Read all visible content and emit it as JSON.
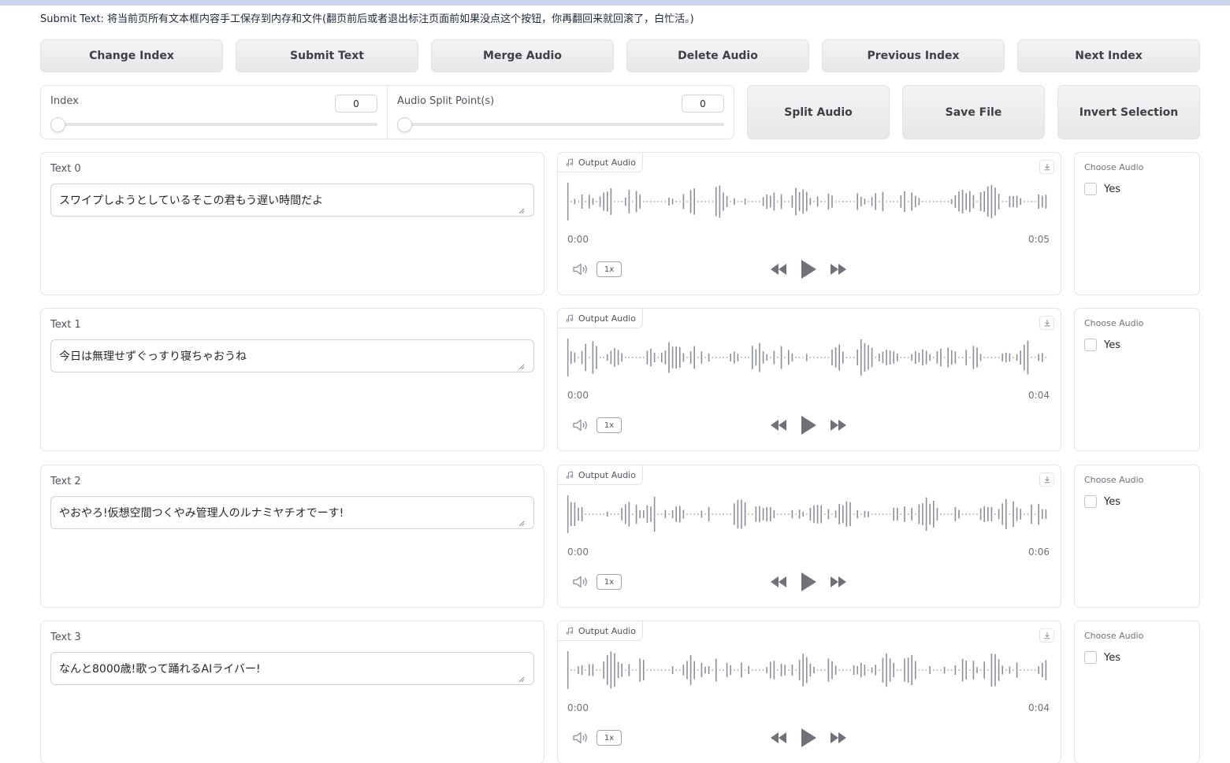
{
  "notice": "Submit Text: 将当前页所有文本框内容手工保存到内存和文件(翻页前后或者退出标注页面前如果没点这个按钮，你再翻回来就回滚了，白忙活。)",
  "toolbar": {
    "change_index": "Change Index",
    "submit_text": "Submit Text",
    "merge_audio": "Merge Audio",
    "delete_audio": "Delete Audio",
    "previous_index": "Previous Index",
    "next_index": "Next Index",
    "split_audio": "Split Audio",
    "save_file": "Save File",
    "invert_selection": "Invert Selection"
  },
  "sliders": {
    "index": {
      "label": "Index",
      "value": "0"
    },
    "split_point": {
      "label": "Audio Split Point(s)",
      "value": "0"
    }
  },
  "rows": [
    {
      "text_label": "Text 0",
      "text": "スワイプしようとしているそこの君もう遅い時間だよ",
      "audio_label": "Output Audio",
      "start": "0:00",
      "end": "0:05",
      "speed": "1x",
      "choose_label": "Choose Audio",
      "option": "Yes"
    },
    {
      "text_label": "Text 1",
      "text": "今日は無理せずぐっすり寝ちゃおうね",
      "audio_label": "Output Audio",
      "start": "0:00",
      "end": "0:04",
      "speed": "1x",
      "choose_label": "Choose Audio",
      "option": "Yes"
    },
    {
      "text_label": "Text 2",
      "text": "やおやろ!仮想空間つくやみ管理人のルナミヤチオでーす!",
      "audio_label": "Output Audio",
      "start": "0:00",
      "end": "0:06",
      "speed": "1x",
      "choose_label": "Choose Audio",
      "option": "Yes"
    },
    {
      "text_label": "Text 3",
      "text": "なんと8000歳!歌って踊れるAIライバー!",
      "audio_label": "Output Audio",
      "start": "0:00",
      "end": "0:04",
      "speed": "1x",
      "choose_label": "Choose Audio",
      "option": "Yes"
    }
  ],
  "colors": {
    "wave": "#8b8f99",
    "accent_bar": "#c9d5ea"
  },
  "icons": {
    "audio_tag": "music-note-icon",
    "download": "download-icon",
    "volume": "volume-icon",
    "rewind": "rewind-icon",
    "play": "play-icon",
    "forward": "fast-forward-icon"
  }
}
